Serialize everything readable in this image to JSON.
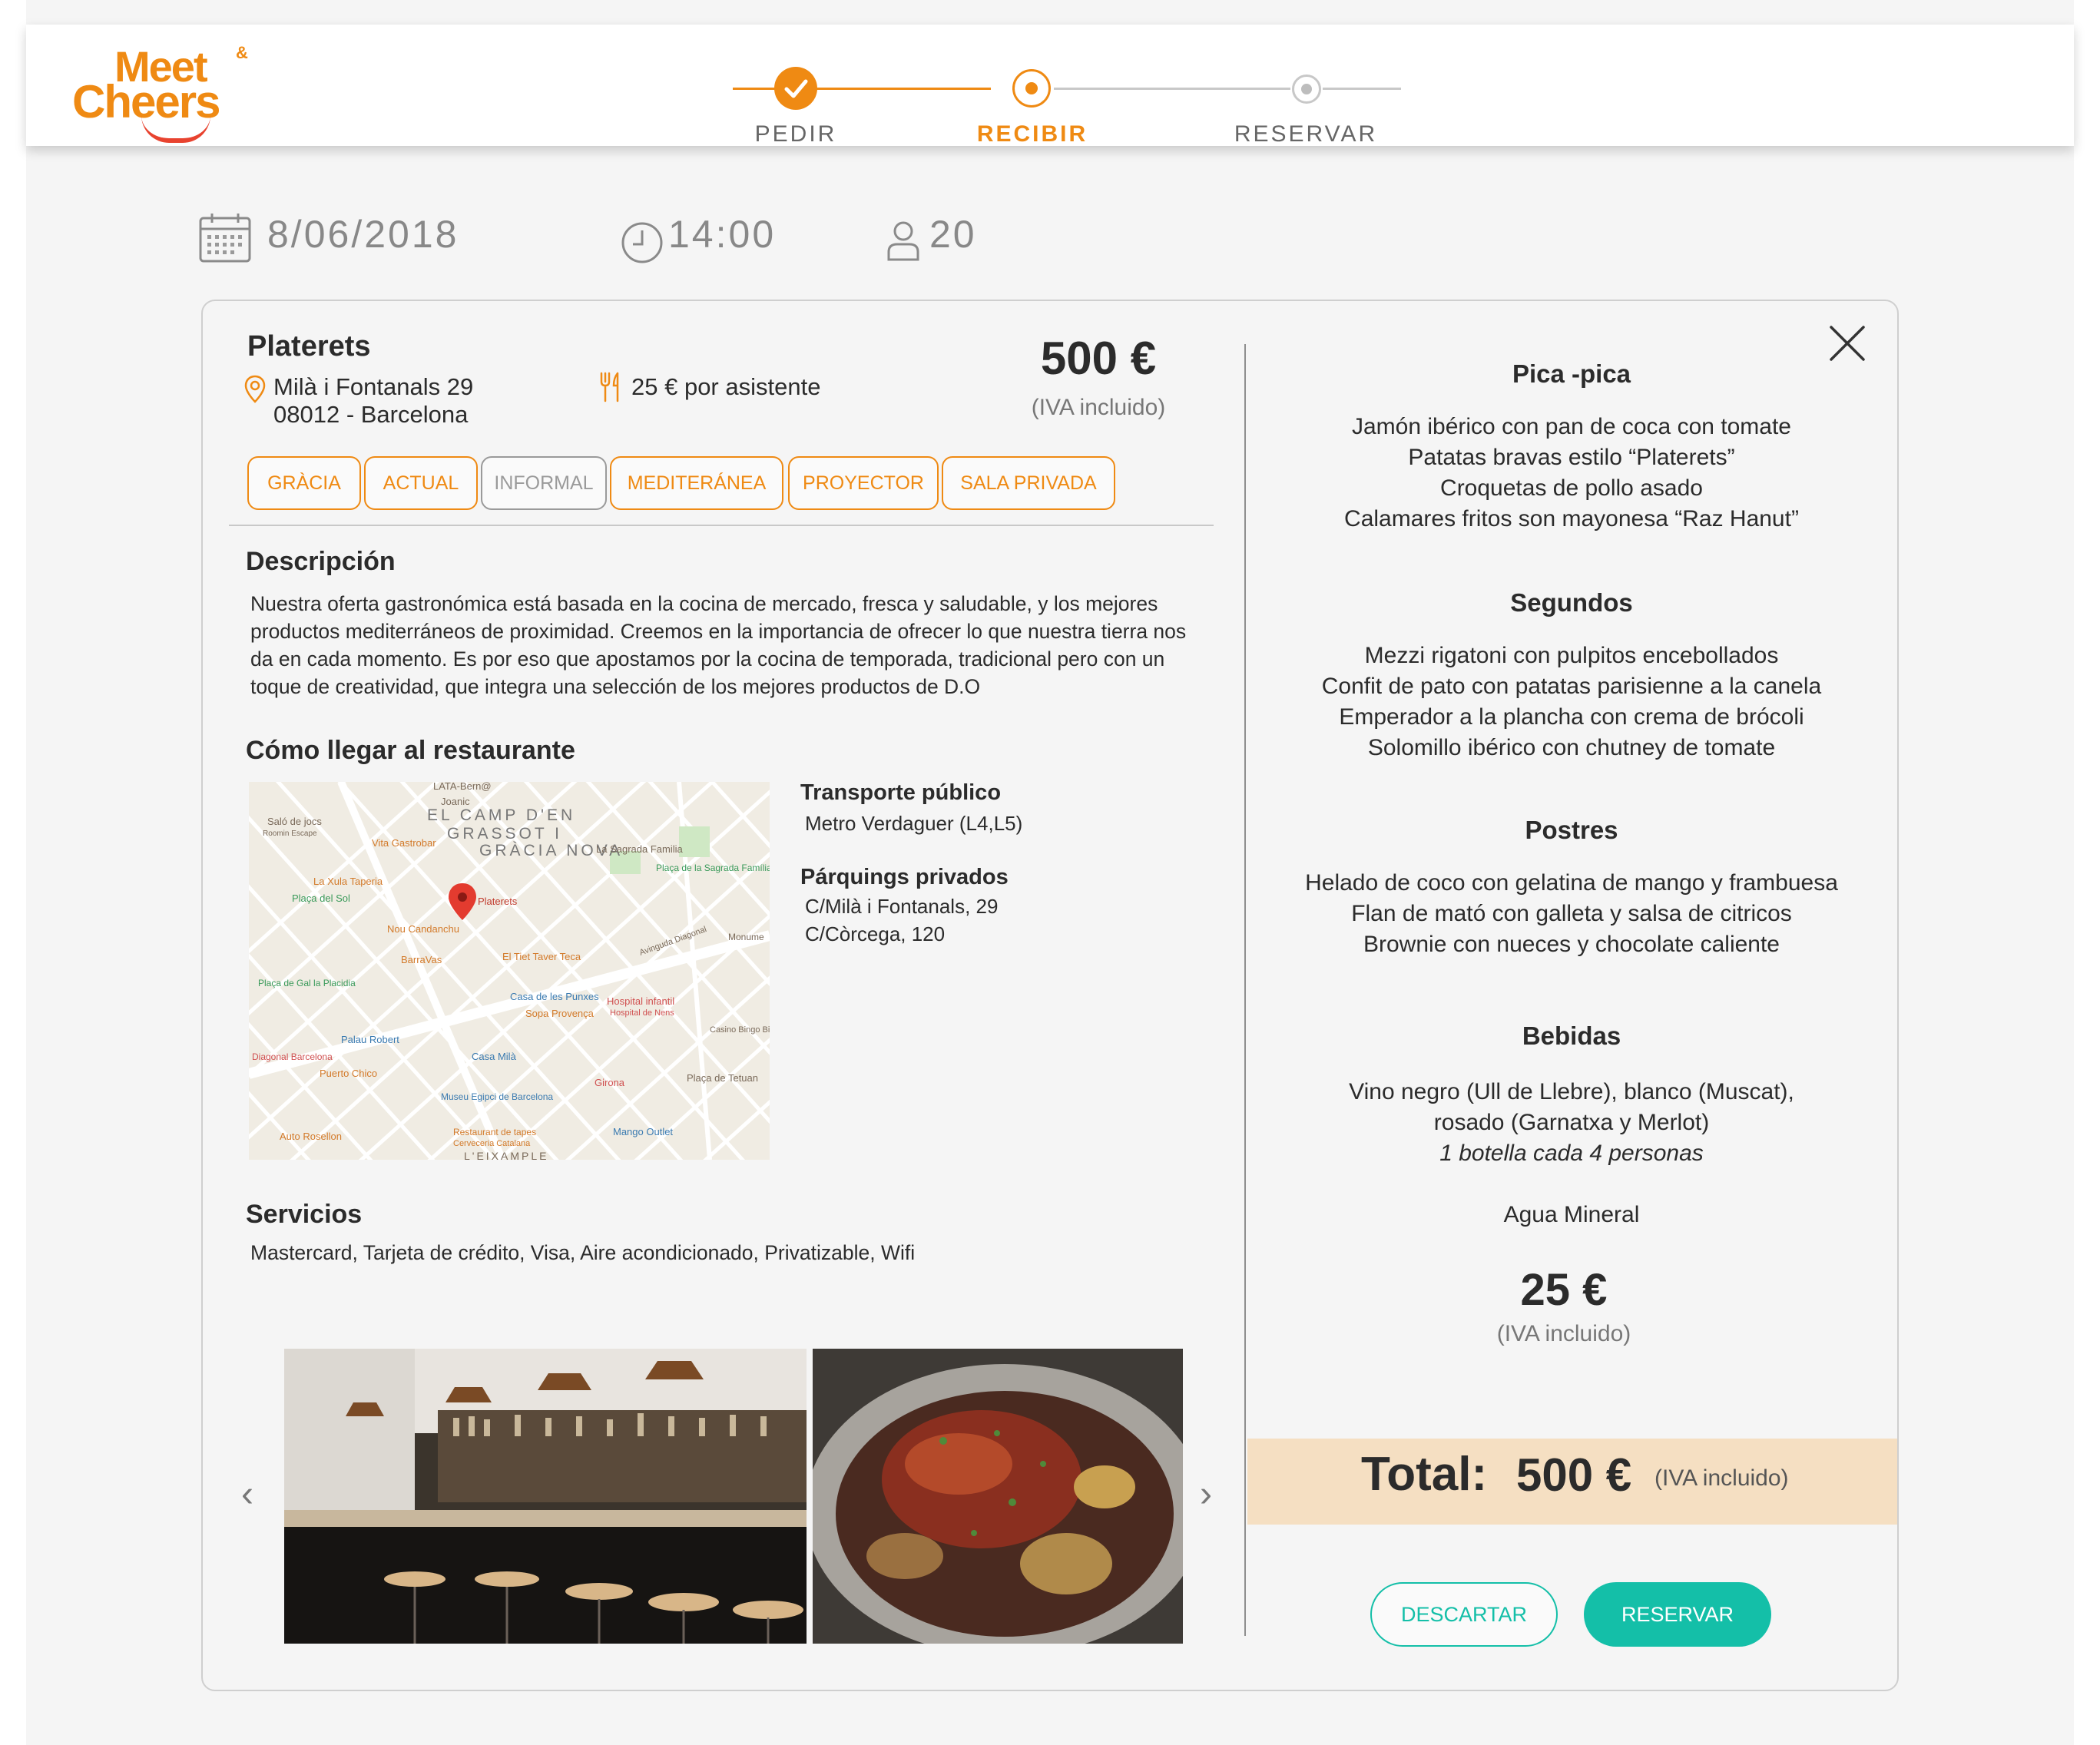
{
  "brand": {
    "line1": "Meet",
    "amp": "&",
    "line2": "Cheers",
    "color": "#ef8a13"
  },
  "stepper": {
    "steps": [
      {
        "label": "PEDIR",
        "state": "done"
      },
      {
        "label": "RECIBIR",
        "state": "active"
      },
      {
        "label": "RESERVAR",
        "state": "pending"
      }
    ],
    "accent": "#ef8a13"
  },
  "booking": {
    "date": "8/06/2018",
    "time": "14:00",
    "guests": "20"
  },
  "restaurant": {
    "name": "Platerets",
    "address_line1": "Milà i Fontanals 29",
    "address_line2": "08012 - Barcelona",
    "price_per_person": "25 € por asistente",
    "total_price": "500 €",
    "vat_note": "(IVA incluido)",
    "tags": [
      "GRÀCIA",
      "ACTUAL",
      "INFORMAL",
      "MEDITERÁNEA",
      "PROYECTOR",
      "SALA PRIVADA"
    ]
  },
  "description": {
    "title": "Descripción",
    "text": "Nuestra oferta gastronómica está basada en la cocina de mercado, fresca y saludable, y los mejores productos mediterráneos de proximidad. Creemos en la importancia de ofrecer lo que nuestra tierra nos da en cada momento. Es por eso que apostamos por la cocina de temporada, tradicional pero con un toque de creatividad, que integra una selección de los mejores productos de D.O"
  },
  "directions": {
    "title": "Cómo llegar al restaurante",
    "public_transport_title": "Transporte público",
    "public_transport": "Metro Verdaguer (L4,L5)",
    "parking_title": "Párquings privados",
    "parking": [
      "C/Milà i Fontanals, 29",
      "C/Còrcega, 120"
    ],
    "map_labels": {
      "marker": "Platerets",
      "district1": "EL CAMP D'EN",
      "district2": "GRASSOT I",
      "district3": "GRÀCIA NOVA",
      "poi": [
        "LATA-Bern@",
        "Joanic",
        "Saló de jocs",
        "Roomin Escape",
        "Vita Gastrobar",
        "La Sagrada Familia",
        "Plaça de la Sagrada Família",
        "La Xula Taperia",
        "Plaça del Sol",
        "Nou Candanchu",
        "BarraVas",
        "El Tiet Taver Teca",
        "Avinguda Diagonal",
        "Monume",
        "Plaça de Gal la Placidia",
        "Casa de les Punxes",
        "Hospital infantil",
        "Hospital de Nens",
        "Sopa Provença",
        "Casino Bingo Billares",
        "Palau Robert",
        "Diagonal Barcelona",
        "Puerto Chico",
        "Casa Milà",
        "Girona",
        "Plaça de Tetuan",
        "Museu Egipci de Barcelona",
        "Auto Rosellon",
        "Restaurant de tapes",
        "Cerveceria Catalana",
        "Mango Outlet",
        "L'EIXAMPLE"
      ]
    }
  },
  "services": {
    "title": "Servicios",
    "text": "Mastercard, Tarjeta de crédito, Visa, Aire acondicionado, Privatizable, Wifi"
  },
  "gallery": {
    "prev": "‹",
    "next": "›"
  },
  "menu": {
    "sections": [
      {
        "title": "Pica -pica",
        "items": [
          "Jamón ibérico con pan de coca con tomate",
          "Patatas bravas estilo “Platerets”",
          "Croquetas de pollo asado",
          "Calamares fritos son mayonesa “Raz Hanut”"
        ]
      },
      {
        "title": "Segundos",
        "items": [
          "Mezzi rigatoni con pulpitos encebollados",
          "Confit de pato con patatas parisienne a la canela",
          "Emperador a la plancha con crema de brócoli",
          "Solomillo ibérico con chutney de tomate"
        ]
      },
      {
        "title": "Postres",
        "items": [
          "Helado de coco con gelatina de mango y frambuesa",
          "Flan de mató con galleta y salsa de citricos",
          "Brownie con nueces y chocolate caliente"
        ]
      },
      {
        "title": "Bebidas",
        "items": [
          "Vino negro (Ull de Llebre), blanco (Muscat),",
          "rosado (Garnatxa y Merlot)"
        ],
        "note": "1 botella cada 4 personas",
        "extra": "Agua Mineral"
      }
    ],
    "price": "25 €",
    "vat_note": "(IVA incluido)"
  },
  "total": {
    "label": "Total:",
    "value": "500 €",
    "vat_note": "(IVA incluido)"
  },
  "actions": {
    "discard": "DESCARTAR",
    "book": "RESERVAR",
    "accent": "#14bfa8"
  }
}
